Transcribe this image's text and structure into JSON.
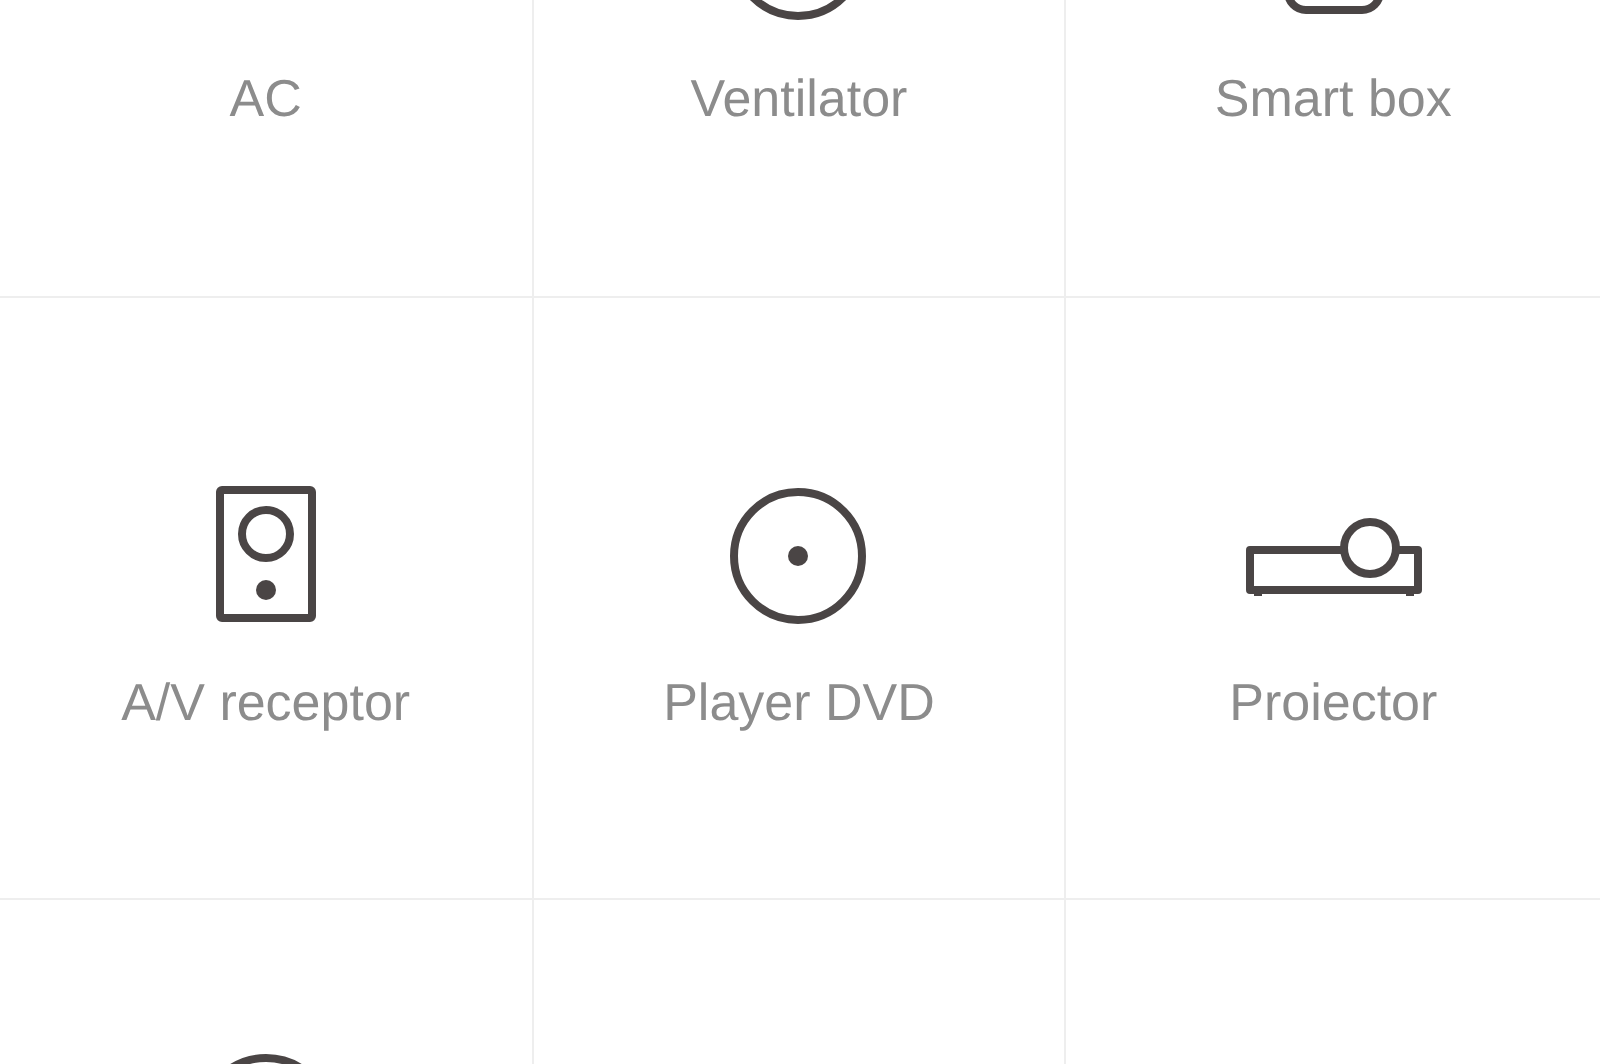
{
  "devices": [
    {
      "label": "AC",
      "kind": "none"
    },
    {
      "label": "Ventilator",
      "kind": "fan"
    },
    {
      "label": "Smart box",
      "kind": "box"
    },
    {
      "label": "A/V receptor",
      "kind": "speaker"
    },
    {
      "label": "Player DVD",
      "kind": "disc"
    },
    {
      "label": "Proiector",
      "kind": "projector"
    },
    {
      "kind": "round"
    },
    {
      "kind": "none"
    },
    {
      "kind": "none"
    }
  ]
}
